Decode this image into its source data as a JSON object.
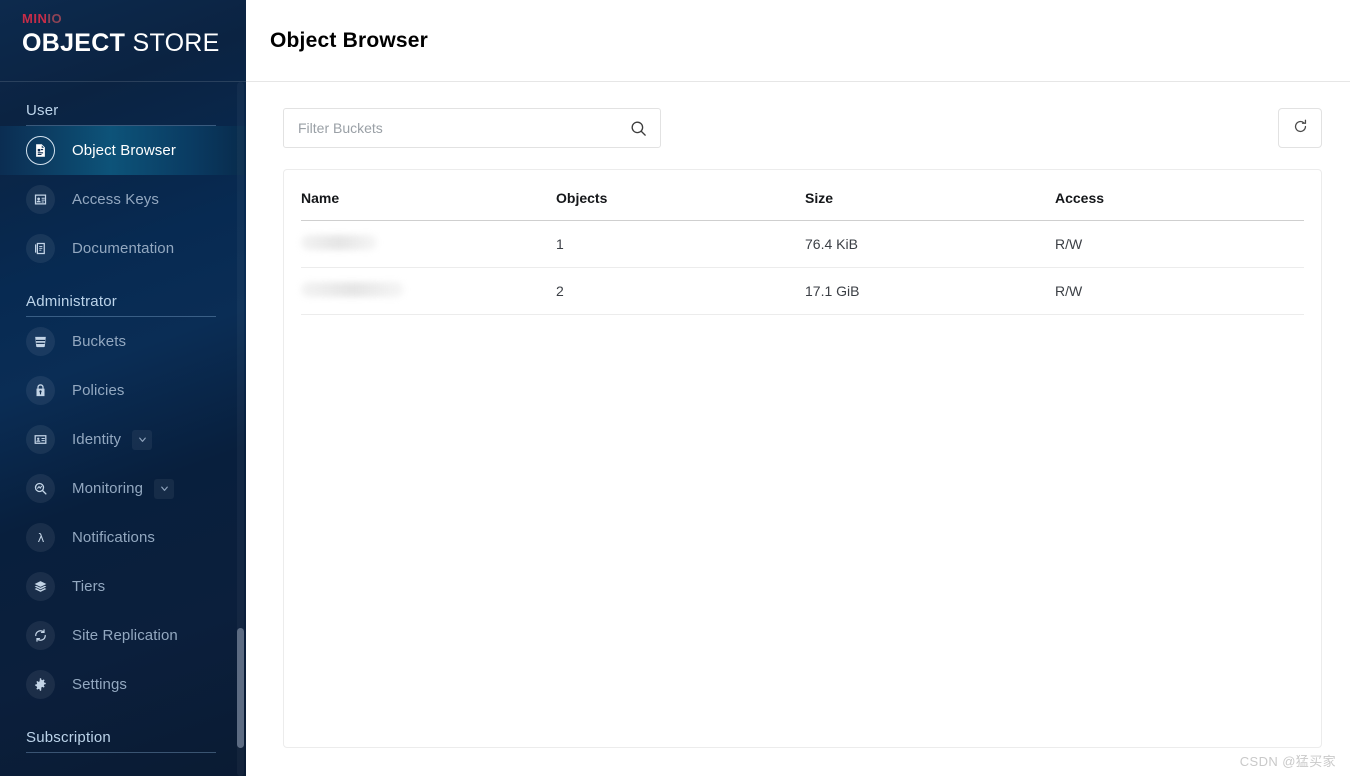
{
  "brand": {
    "logo_top_red": "MIN",
    "logo_top_muted": "IO",
    "logo_bold": "OBJECT",
    "logo_light": "STORE",
    "red_hex": "#c72c48",
    "muted_hex": "#8e4355"
  },
  "sidebar": {
    "sections": [
      {
        "title": "User",
        "items": [
          {
            "label": "Object Browser",
            "icon": "object-browser-icon",
            "selected": true,
            "expandable": false
          },
          {
            "label": "Access Keys",
            "icon": "access-keys-icon",
            "selected": false,
            "expandable": false
          },
          {
            "label": "Documentation",
            "icon": "documentation-icon",
            "selected": false,
            "expandable": false
          }
        ]
      },
      {
        "title": "Administrator",
        "items": [
          {
            "label": "Buckets",
            "icon": "bucket-icon",
            "selected": false,
            "expandable": false
          },
          {
            "label": "Policies",
            "icon": "policies-icon",
            "selected": false,
            "expandable": false
          },
          {
            "label": "Identity",
            "icon": "identity-icon",
            "selected": false,
            "expandable": true
          },
          {
            "label": "Monitoring",
            "icon": "monitoring-icon",
            "selected": false,
            "expandable": true
          },
          {
            "label": "Notifications",
            "icon": "notifications-lambda-icon",
            "selected": false,
            "expandable": false
          },
          {
            "label": "Tiers",
            "icon": "tiers-layers-icon",
            "selected": false,
            "expandable": false
          },
          {
            "label": "Site Replication",
            "icon": "site-replication-icon",
            "selected": false,
            "expandable": false
          },
          {
            "label": "Settings",
            "icon": "gear-icon",
            "selected": false,
            "expandable": false
          }
        ]
      },
      {
        "title": "Subscription",
        "items": []
      }
    ]
  },
  "header": {
    "title": "Object Browser"
  },
  "toolbar": {
    "filter_placeholder": "Filter Buckets",
    "filter_value": "",
    "search_icon": "search-icon",
    "refresh_icon": "refresh-icon",
    "refresh_label": ""
  },
  "table": {
    "columns": [
      "Name",
      "Objects",
      "Size",
      "Access"
    ],
    "rows": [
      {
        "name": "",
        "name_redacted": true,
        "objects": "1",
        "size": "76.4 KiB",
        "access": "R/W"
      },
      {
        "name": "",
        "name_redacted": true,
        "objects": "2",
        "size": "17.1 GiB",
        "access": "R/W"
      }
    ]
  },
  "watermark": {
    "text": "CSDN @猛买家"
  }
}
